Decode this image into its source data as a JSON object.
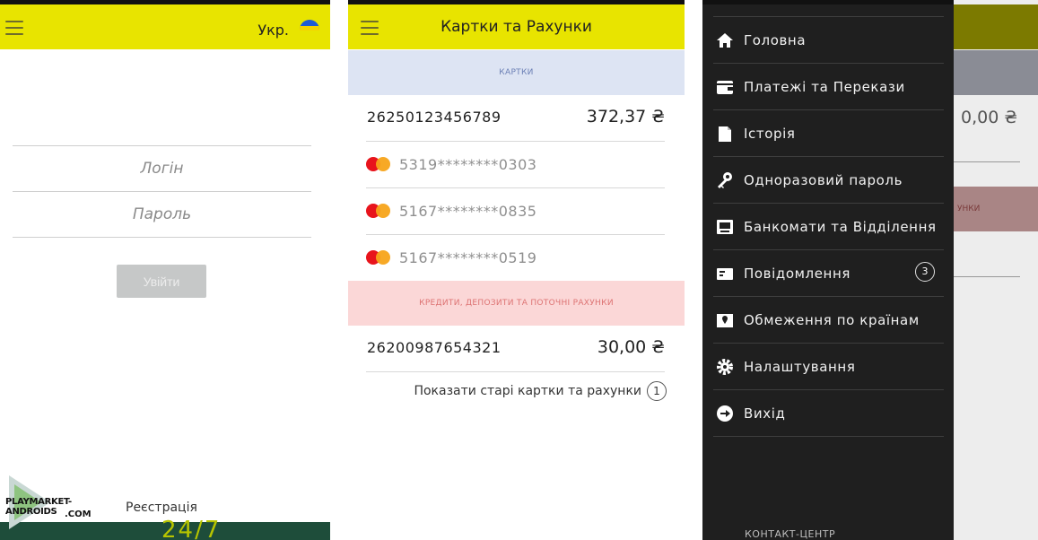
{
  "screen1": {
    "lang_label": "Укр.",
    "login_placeholder": "Логін",
    "password_placeholder": "Пароль",
    "login_button": "Увійти",
    "register_link": "Реєстрація",
    "bottom_banner_text": "24/7"
  },
  "screen2": {
    "title": "Картки та Рахунки",
    "cards_section": "КАРТКИ",
    "main_account": {
      "number": "26250123456789",
      "amount": "372,37 ₴"
    },
    "cards": [
      {
        "masked": "5319********0303"
      },
      {
        "masked": "5167********0835"
      },
      {
        "masked": "5167********0519"
      }
    ],
    "credits_section": "КРЕДИТИ, ДЕПОЗИТИ ТА ПОТОЧНІ РАХУНКИ",
    "current_account": {
      "number": "26200987654321",
      "amount": "30,00 ₴"
    },
    "show_old": "Показати старі картки та рахунки",
    "show_old_count": "1"
  },
  "screen3": {
    "menu": [
      {
        "label": "Головна",
        "icon": "home-icon"
      },
      {
        "label": "Платежі та Перекази",
        "icon": "wallet-icon"
      },
      {
        "label": "Історія",
        "icon": "document-icon"
      },
      {
        "label": "Одноразовий пароль",
        "icon": "key-icon"
      },
      {
        "label": "Банкомати та Відділення",
        "icon": "atm-icon"
      },
      {
        "label": "Повідомлення",
        "icon": "mail-icon",
        "badge": "3"
      },
      {
        "label": "Обмеження по країнам",
        "icon": "map-pin-icon"
      },
      {
        "label": "Налаштування",
        "icon": "gear-icon"
      },
      {
        "label": "Вихід",
        "icon": "exit-icon"
      }
    ],
    "contact_label": "КОНТАКТ-ЦЕНТР",
    "behind_amount": "0,00 ₴",
    "behind_section_fragment": "УНКИ"
  },
  "watermark": {
    "line1": "PLAYMARKET-ANDROIDS",
    "line2": ".COM"
  },
  "colors": {
    "topbar": "#e8e400",
    "cards_section_bg": "#dde4f3",
    "credits_section_bg": "#fbd7d7",
    "drawer_bg": "#1f1f1f",
    "banner_bg": "#1e4d3a"
  }
}
